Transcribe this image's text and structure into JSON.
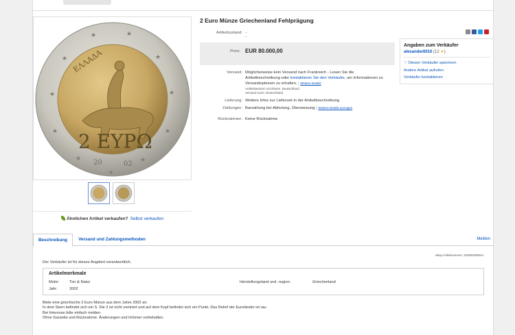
{
  "item": {
    "title": "2 Euro Münze Griechenland Fehlprägung",
    "condition_label": "Artikelzustand:",
    "condition_value": "--",
    "price_label": "Preis:",
    "price_value": "EUR 80.000,00"
  },
  "image": {
    "coin_top_text": "ΕΛΛΑΔΑ",
    "coin_value_text": "2 ΕΥΡΩ",
    "coin_year_left": "20",
    "coin_year_right": "02"
  },
  "shipping": {
    "label": "Versand:",
    "text_1": "Möglicherweise kein Versand nach Frankreich - Lesen Sie die",
    "text_2a": "Artikelbeschreibung oder ",
    "text_2_link": "kontaktieren Sie den Verkäufer",
    "text_2b": ", um Informationen zu",
    "text_3": "Versandoptionen zu erhalten.",
    "details_link": "Weitere Details",
    "location": "Artikelstandort:  Kirchheim, Deutschland",
    "ships_to": "Versand nach:  Deutschland"
  },
  "delivery": {
    "label": "Lieferung:",
    "value": "Weitere Infos zur Lieferzeit in der Artikelbeschreibung"
  },
  "payment": {
    "label": "Zahlungen:",
    "value": "Barzahlung bei Abholung,  Überweisung",
    "link": "Weitere Details anzeigen"
  },
  "returns": {
    "label": "Rücknahmen:",
    "value": "Keine Rücknahme"
  },
  "seller": {
    "heading": "Angaben zum Verkäufer",
    "name": "alexander6010",
    "score": "(12",
    "score_close": ")",
    "save": "Diesen Verkäufer speichern",
    "other_items": "Andere Artikel aufrufen",
    "contact": "Verkäufer kontaktieren"
  },
  "sell_similar": {
    "text": "Ähnlichen Artikel verkaufen?",
    "link": "Selbst verkaufen"
  },
  "tabs": [
    {
      "label": "Beschreibung"
    },
    {
      "label": "Versand und Zahlungsmethoden"
    }
  ],
  "report_label": "Melden",
  "description": {
    "item_number": "eBay-Artikelnummer:  263936308044",
    "responsibility": "Der Verkäufer ist für dieses Angebot verantwortlich.",
    "specifics_heading": "Artikelmerkmale",
    "motiv_label": "Motiv:",
    "motiv_value": "Tier & Natur",
    "year_label": "Jahr:",
    "year_value": "2002",
    "origin_label": "Herstellungsland und -region:",
    "origin_value": "Griechenland",
    "lines": [
      "Biete eine griechische 2 Euro Münze aus dem Jahre 2002 an.",
      "In dem Stern befindet sich ein S. Die 2 ist nicht zentriert und auf dem Kopf befindet sich ein Punkt. Das Relief der Euroländer ist rau.",
      "Bei Interesse bitte einfach melden.",
      "Ohne Garantie und Rücknahme. Änderungen und Irrtümer vorbehalten."
    ]
  },
  "colors": {
    "link": "#0654ba",
    "price_bg": "#ececec",
    "coin_ring": "#c9c6bd",
    "coin_center": "#c8a763"
  }
}
